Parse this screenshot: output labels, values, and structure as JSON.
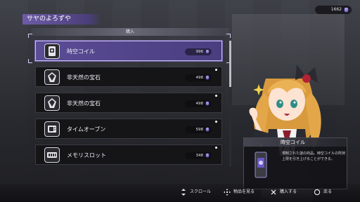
{
  "shop": {
    "title": "サヤのよろずや"
  },
  "wallet": {
    "amount": "1662",
    "currency_icon": "coin-icon"
  },
  "panel": {
    "header": "購入"
  },
  "items": [
    {
      "name": "時空コイル",
      "price": "996",
      "icon": "coil-card-icon",
      "selected": true,
      "new": false
    },
    {
      "name": "非天然の宝石",
      "price": "498",
      "icon": "gem-icon",
      "selected": false,
      "new": true
    },
    {
      "name": "非天然の宝石",
      "price": "498",
      "icon": "gem-icon",
      "selected": false,
      "new": true
    },
    {
      "name": "タイムオーブン",
      "price": "598",
      "icon": "oven-icon",
      "selected": false,
      "new": true
    },
    {
      "name": "メモリスロット",
      "price": "348",
      "icon": "memory-slot-icon",
      "selected": false,
      "new": true
    }
  ],
  "description": {
    "title": "時空コイル",
    "text": "規制された謎の商品。時空コイルの所持上限を引き上げることができる。"
  },
  "footer": {
    "scroll": "スクロール",
    "view_item": "物品を見る",
    "buy": "購入する",
    "back": "戻る"
  },
  "colors": {
    "accent": "#5b4c96",
    "highlight_border": "#c9bff0",
    "title_bar": "#6e5aa8"
  }
}
